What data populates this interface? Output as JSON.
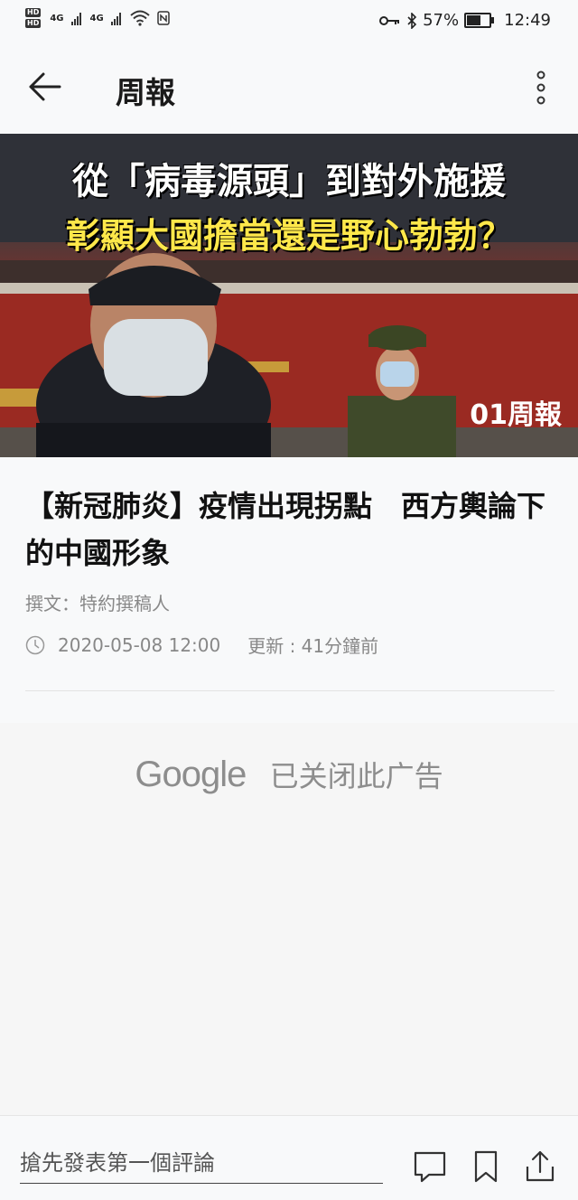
{
  "status_bar": {
    "hd1": "HD",
    "hd2": "HD",
    "net1": "4G",
    "net2": "4G",
    "battery_percent": "57%",
    "battery_level": 0.57,
    "time": "12:49"
  },
  "app_bar": {
    "title": "周報"
  },
  "hero": {
    "line1": "從「病毒源頭」到對外施援",
    "line2": "彰顯大國擔當還是野心勃勃？",
    "logo": "01周報"
  },
  "article": {
    "headline": "【新冠肺炎】疫情出現拐點　西方輿論下的中國形象",
    "byline": "撰文：特約撰稿人",
    "date": "2020-05-08 12:00",
    "updated": "更新 : 41分鐘前"
  },
  "ad": {
    "brand": "Google",
    "message": "已关闭此广告"
  },
  "bottom_bar": {
    "comment_placeholder": "搶先發表第一個評論"
  },
  "icons": {
    "back": "back-arrow-icon",
    "more": "more-vertical-icon",
    "clock": "clock-icon",
    "comment": "comment-icon",
    "bookmark": "bookmark-icon",
    "share": "share-icon"
  }
}
